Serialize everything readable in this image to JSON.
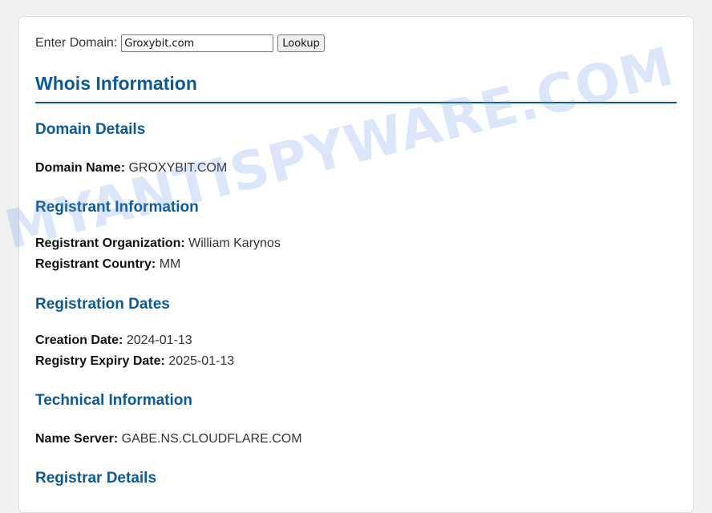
{
  "lookup": {
    "label": "Enter Domain:",
    "input_value": "Groxybit.com",
    "button_label": "Lookup"
  },
  "title": "Whois Information",
  "sections": {
    "domain": {
      "heading": "Domain Details",
      "fields": [
        {
          "label": "Domain Name:",
          "value": "GROXYBIT.COM"
        }
      ]
    },
    "registrant": {
      "heading": "Registrant Information",
      "fields": [
        {
          "label": "Registrant Organization:",
          "value": "William Karynos"
        },
        {
          "label": "Registrant Country:",
          "value": "MM"
        }
      ]
    },
    "dates": {
      "heading": "Registration Dates",
      "fields": [
        {
          "label": "Creation Date:",
          "value": "2024-01-13"
        },
        {
          "label": "Registry Expiry Date:",
          "value": "2025-01-13"
        }
      ]
    },
    "technical": {
      "heading": "Technical Information",
      "fields": [
        {
          "label": "Name Server:",
          "value": "GABE.NS.CLOUDFLARE.COM"
        }
      ]
    },
    "registrar": {
      "heading": "Registrar Details"
    }
  },
  "watermark": "MYANTISPYWARE.COM",
  "colors": {
    "heading": "#0b5a96",
    "background": "#f1f1f1",
    "card": "#ffffff"
  }
}
